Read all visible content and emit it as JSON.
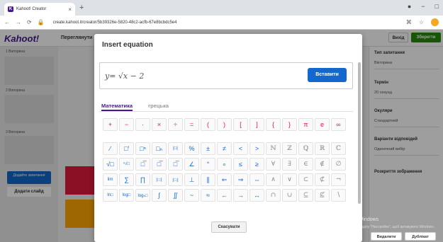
{
  "browser": {
    "tab_title": "Kahoot! Creator",
    "url": "create.kahoot.it/creator/5b39326e-5820-48c2-acfb-67e8bcbdc5e4"
  },
  "app": {
    "logo": "Kahoot!",
    "title_tab": "Переглянути",
    "save_label": "Зберегти",
    "exit_label": "Вихід",
    "slides": [
      {
        "label": "1 Вікторина",
        "sub": "Виберіть відповідь..."
      },
      {
        "label": "2 Вікторина",
        "sub": "Виберіть відповідь..."
      },
      {
        "label": "3 Вікторина",
        "sub": "Виберіть відповідь..."
      }
    ],
    "add_question": "Додайте запитання",
    "add_slide": "Додати слайд",
    "right_panel": {
      "qtype_header": "Тип запитання",
      "qtype_value": "Вікторина",
      "time_header": "Термін",
      "time_value": "20 секунд",
      "points_header": "Окуляри",
      "points_value": "Стандартний",
      "answers_header": "Варіанти відповідей",
      "answers_value": "Одиночний вибір",
      "reveal_header": "Розкриття зображення",
      "delete_label": "Видалити",
      "duplicate_label": "Дублікат"
    },
    "watermark_title": "Активація Windows",
    "watermark_sub": "Перейдіть до розділу \"Настройки\", щоб активувати Windows."
  },
  "modal": {
    "title": "Insert equation",
    "equation": "y= √x − 2",
    "insert_label": "Вставити",
    "tabs": [
      "Математика",
      "грецька"
    ],
    "active_tab": "Математика",
    "row1": [
      "+",
      "−",
      "·",
      "×",
      "÷",
      "=",
      "(",
      ")",
      "[",
      "]",
      "{",
      "}",
      "π",
      "e",
      "∞"
    ],
    "row2": [
      "⁄",
      "□′",
      "□ⁿ",
      "□ₙ",
      "|□|",
      "%",
      "±",
      "≠",
      "<",
      ">",
      "ℕ",
      "ℤ",
      "ℚ",
      "ℝ",
      "ℂ"
    ],
    "row3": [
      "√□",
      "ⁿ√□",
      "□̅",
      "□̅",
      "□̅",
      "∠",
      "°",
      "∘",
      "≤",
      "≥",
      "∀",
      "∃",
      "∈",
      "∉",
      "∅"
    ],
    "row4": [
      "lim",
      "∑",
      "∏",
      "⌈□⌉",
      "⌊□⌋",
      "⊥",
      "∥",
      "⇐",
      "⇒",
      "⇔",
      "∧",
      "∨",
      "⊂",
      "⊄",
      "¬"
    ],
    "row5": [
      "ln□",
      "log□",
      "logₙ□",
      "∫",
      "∬",
      "~",
      "≈",
      "←",
      "→",
      "↔",
      "∩",
      "∪",
      "⊆",
      "⊈",
      "∖"
    ],
    "cancel_label": "Скасувати"
  }
}
